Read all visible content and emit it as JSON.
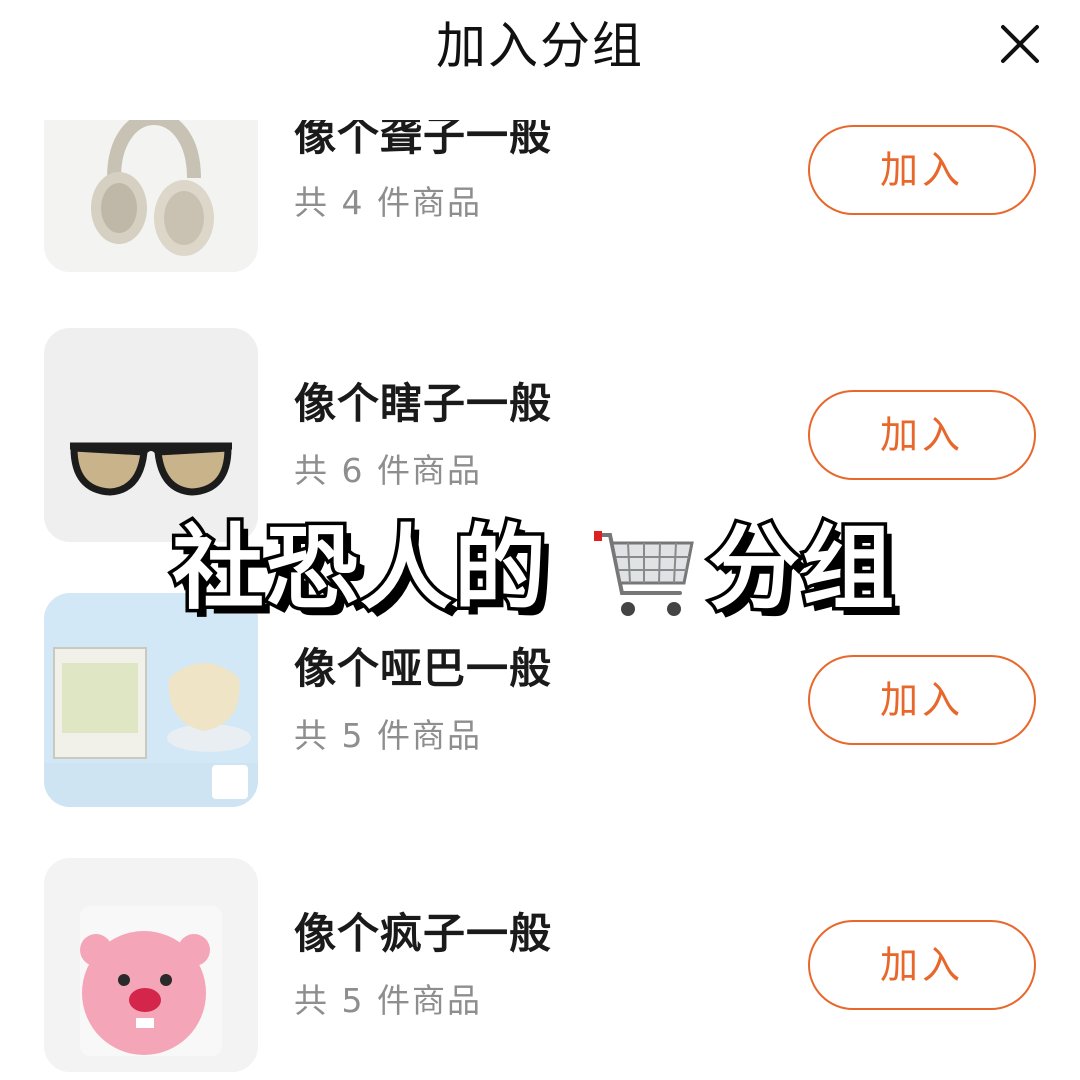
{
  "header": {
    "title": "加入分组"
  },
  "groups": [
    {
      "name": "像个聋子一般",
      "count": "共 4 件商品",
      "button": "加入",
      "thumb": "headphones"
    },
    {
      "name": "像个瞎子一般",
      "count": "共 6 件商品",
      "button": "加入",
      "thumb": "sunglasses"
    },
    {
      "name": "像个哑巴一般",
      "count": "共 5 件商品",
      "button": "加入",
      "thumb": "face-mask-box"
    },
    {
      "name": "像个疯子一般",
      "count": "共 5 件商品",
      "button": "加入",
      "thumb": "pink-beaver-plush"
    }
  ],
  "overlay": {
    "left": "社恐人的",
    "icon": "shopping-cart-icon",
    "right": "分组"
  },
  "colors": {
    "accent": "#e8672b",
    "title": "#111111",
    "muted": "#8e8e8e"
  }
}
